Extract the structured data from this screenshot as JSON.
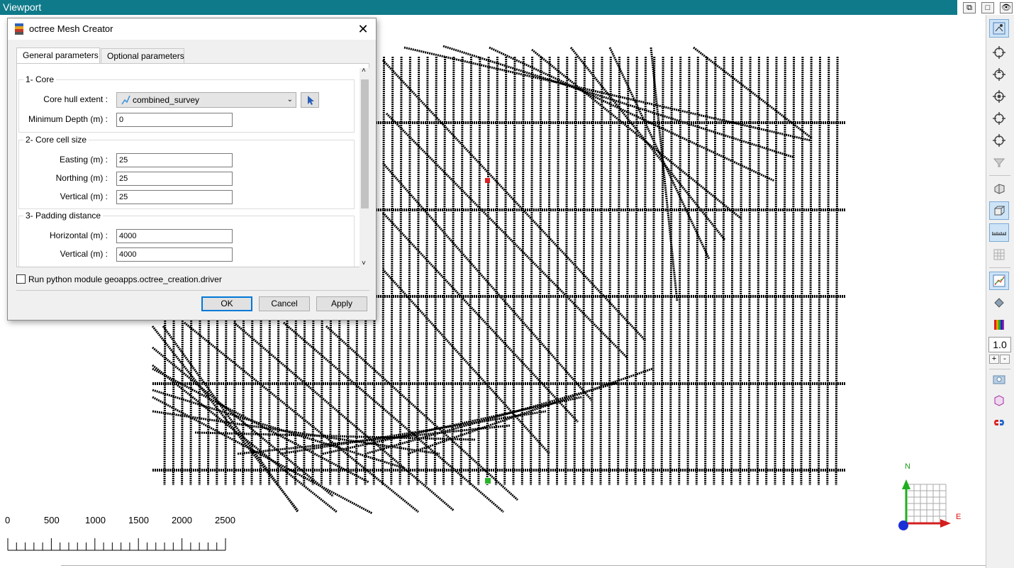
{
  "viewport": {
    "title": "Viewport",
    "scale_labels": [
      "0",
      "500",
      "1000",
      "1500",
      "2000",
      "2500"
    ],
    "compass": {
      "north": "N",
      "east": "E"
    },
    "zoom_value": "1.0",
    "zoom_in": "+",
    "zoom_out": "-"
  },
  "dialog": {
    "title": "octree Mesh Creator",
    "tabs": [
      "General parameters",
      "Optional parameters"
    ],
    "groups": {
      "core": {
        "title": "1- Core",
        "hull_label": "Core hull extent :",
        "hull_value": "combined_survey",
        "min_depth_label": "Minimum Depth (m) :",
        "min_depth_value": "0"
      },
      "cell": {
        "title": "2- Core cell size",
        "easting_label": "Easting (m) :",
        "easting_value": "25",
        "northing_label": "Northing (m) :",
        "northing_value": "25",
        "vertical_label": "Vertical (m) :",
        "vertical_value": "25"
      },
      "padding": {
        "title": "3- Padding distance",
        "horizontal_label": "Horizontal (m) :",
        "horizontal_value": "4000",
        "vertical_label": "Vertical (m) :",
        "vertical_value": "4000"
      }
    },
    "run_checkbox_label": "Run python module geoapps.octree_creation.driver",
    "buttons": {
      "ok": "OK",
      "cancel": "Cancel",
      "apply": "Apply"
    }
  },
  "colors": {
    "accent": "#0f7a8a",
    "dialog_default_border": "#0078d7"
  }
}
